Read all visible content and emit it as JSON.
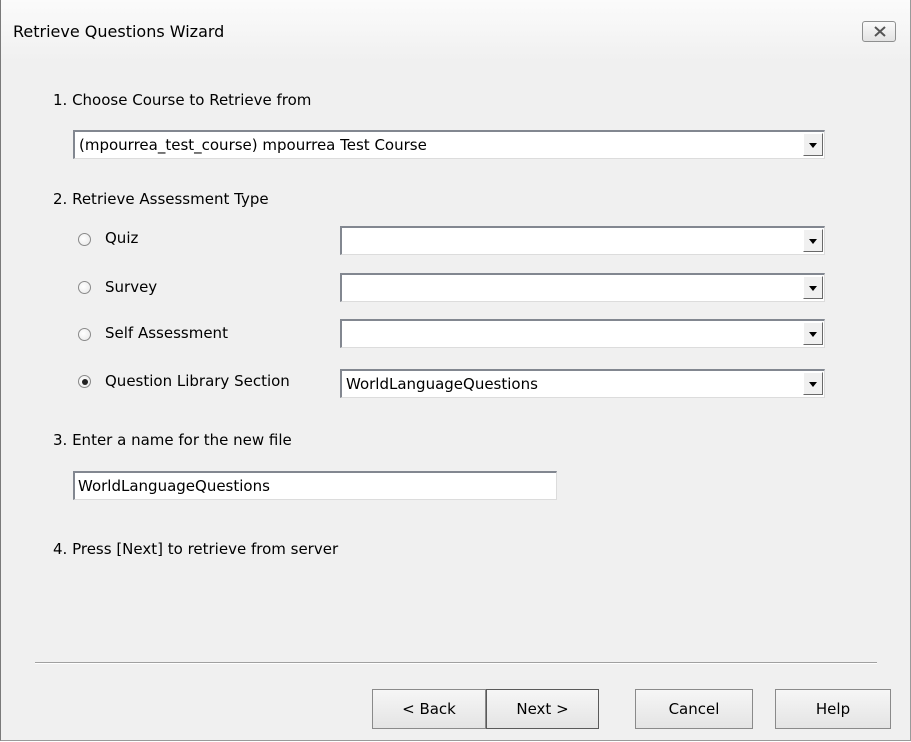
{
  "window": {
    "title": "Retrieve Questions Wizard"
  },
  "step1": {
    "label": "1. Choose Course to Retrieve from",
    "course_value": "(mpourrea_test_course) mpourrea Test Course"
  },
  "step2": {
    "label": "2. Retrieve Assessment Type",
    "options": [
      {
        "label": "Quiz",
        "checked": false,
        "value": ""
      },
      {
        "label": "Survey",
        "checked": false,
        "value": ""
      },
      {
        "label": "Self Assessment",
        "checked": false,
        "value": ""
      },
      {
        "label": "Question Library Section",
        "checked": true,
        "value": "WorldLanguageQuestions"
      }
    ]
  },
  "step3": {
    "label": "3. Enter a name for the new file",
    "file_name": "WorldLanguageQuestions"
  },
  "step4": {
    "label": "4. Press [Next] to retrieve from server"
  },
  "buttons": {
    "back": "< Back",
    "next": "Next >",
    "cancel": "Cancel",
    "help": "Help"
  },
  "icons": {
    "close": "close-icon",
    "dropdown": "chevron-down-icon"
  }
}
